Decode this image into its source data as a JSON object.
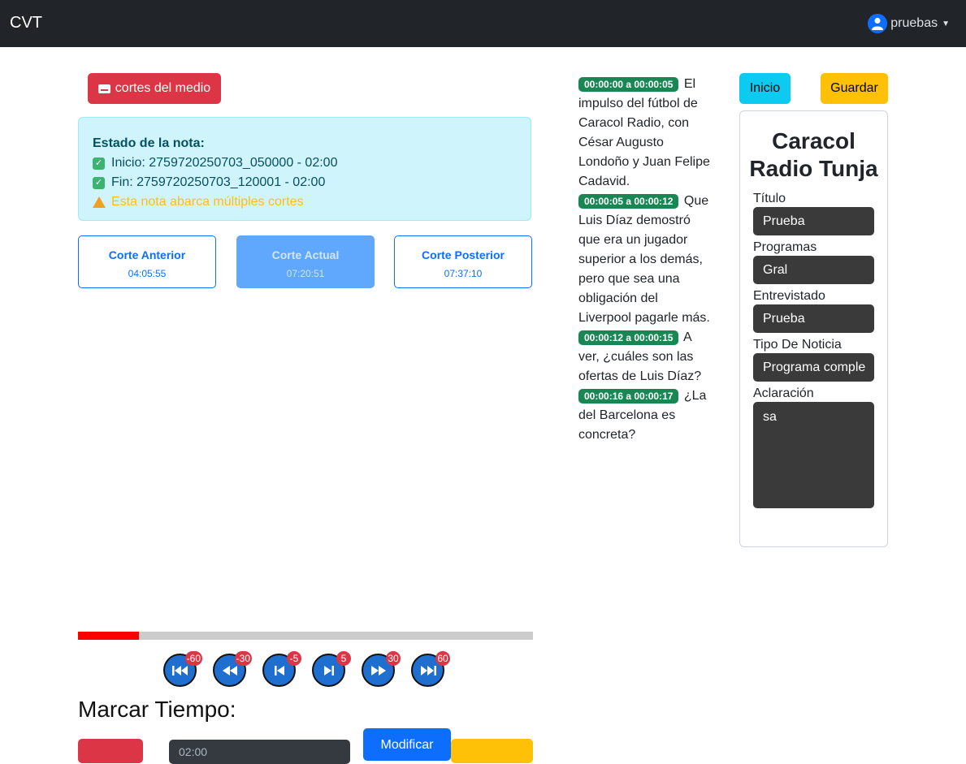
{
  "navbar": {
    "brand": "CVT",
    "user": "pruebas"
  },
  "toolbar": {
    "cortes_label": "cortes del medio"
  },
  "nota": {
    "title": "Estado de la nota:",
    "inicio": "Inicio: 2759720250703_050000 - 02:00",
    "fin": "Fin: 2759720250703_120001 - 02:00",
    "warning": "Esta nota abarca múltiples cortes"
  },
  "cortes": {
    "anterior": {
      "label": "Corte Anterior",
      "time": "04:05:55"
    },
    "actual": {
      "label": "Corte Actual",
      "time": "07:20:51"
    },
    "posterior": {
      "label": "Corte Posterior",
      "time": "07:37:10"
    }
  },
  "player": {
    "progress": 0.134,
    "controls": [
      {
        "name": "skip-back-60",
        "badge": "-60",
        "icon": "double-skip-back"
      },
      {
        "name": "skip-back-30",
        "badge": "-30",
        "icon": "rewind"
      },
      {
        "name": "skip-back-5",
        "badge": "-5",
        "icon": "step-back"
      },
      {
        "name": "skip-forward-5",
        "badge": "5",
        "icon": "step-forward"
      },
      {
        "name": "skip-forward-30",
        "badge": "30",
        "icon": "fast-forward"
      },
      {
        "name": "skip-forward-60",
        "badge": "60",
        "icon": "double-skip-forward"
      }
    ]
  },
  "marcar": {
    "title": "Marcar Tiempo:",
    "time_value": "02:00",
    "modificar_label": "Modificar"
  },
  "transcript": [
    {
      "ts": "00:00:00 a 00:00:05",
      "text": "El impulso del fútbol de Caracol Radio, con César Augusto Londoño y Juan Felipe Cadavid."
    },
    {
      "ts": "00:00:05 a 00:00:12",
      "text": "Que Luis Díaz demostró que era un jugador superior a los demás, pero que sea una obligación del Liverpool pagarle más."
    },
    {
      "ts": "00:00:12 a 00:00:15",
      "text": "A ver, ¿cuáles son las ofertas de Luis Díaz?"
    },
    {
      "ts": "00:00:16 a 00:00:17",
      "text": "¿La del Barcelona es concreta?"
    }
  ],
  "actions": {
    "inicio": "Inicio",
    "guardar": "Guardar"
  },
  "form": {
    "station": "Caracol Radio Tunja",
    "titulo_label": "Título",
    "titulo_value": "Prueba",
    "programas_label": "Programas",
    "programas_value": "Gral",
    "entrevistado_label": "Entrevistado",
    "entrevistado_value": "Prueba",
    "tipo_label": "Tipo De Noticia",
    "tipo_value": "Programa comple",
    "aclaracion_label": "Aclaración",
    "aclaracion_value": "sa"
  }
}
